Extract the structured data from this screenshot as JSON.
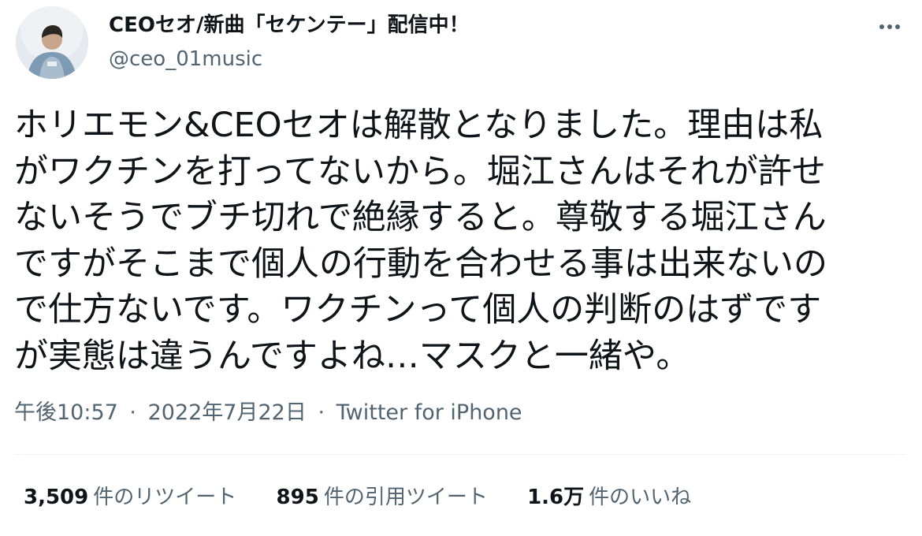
{
  "author": {
    "display_name": "CEOセオ/新曲「セケンテー」配信中！",
    "handle": "@ceo_01music"
  },
  "tweet": {
    "lines": [
      "ホリエモン&CEOセオは解散となりました。理由は私",
      "がワクチンを打ってないから。堀江さんはそれが許せ",
      "ないそうでブチ切れで絶縁すると。尊敬する堀江さん",
      "ですがそこまで個人の行動を合わせる事は出来ないの",
      "で仕方ないです。ワクチンって個人の判断のはずです",
      "が実態は違うんですよね…マスクと一緒や。"
    ]
  },
  "meta": {
    "time": "午後10:57",
    "separator": "·",
    "date": "2022年7月22日",
    "source": "Twitter for iPhone"
  },
  "stats": {
    "retweets": {
      "count": "3,509",
      "label": "件のリツイート"
    },
    "quotes": {
      "count": "895",
      "label": "件の引用ツイート"
    },
    "likes": {
      "count": "1.6万",
      "label": "件のいいね"
    }
  },
  "icons": {
    "more": "more-horizontal-icon"
  },
  "colors": {
    "text_primary": "#0f1419",
    "text_secondary": "#536471",
    "divider": "#eff3f4"
  }
}
